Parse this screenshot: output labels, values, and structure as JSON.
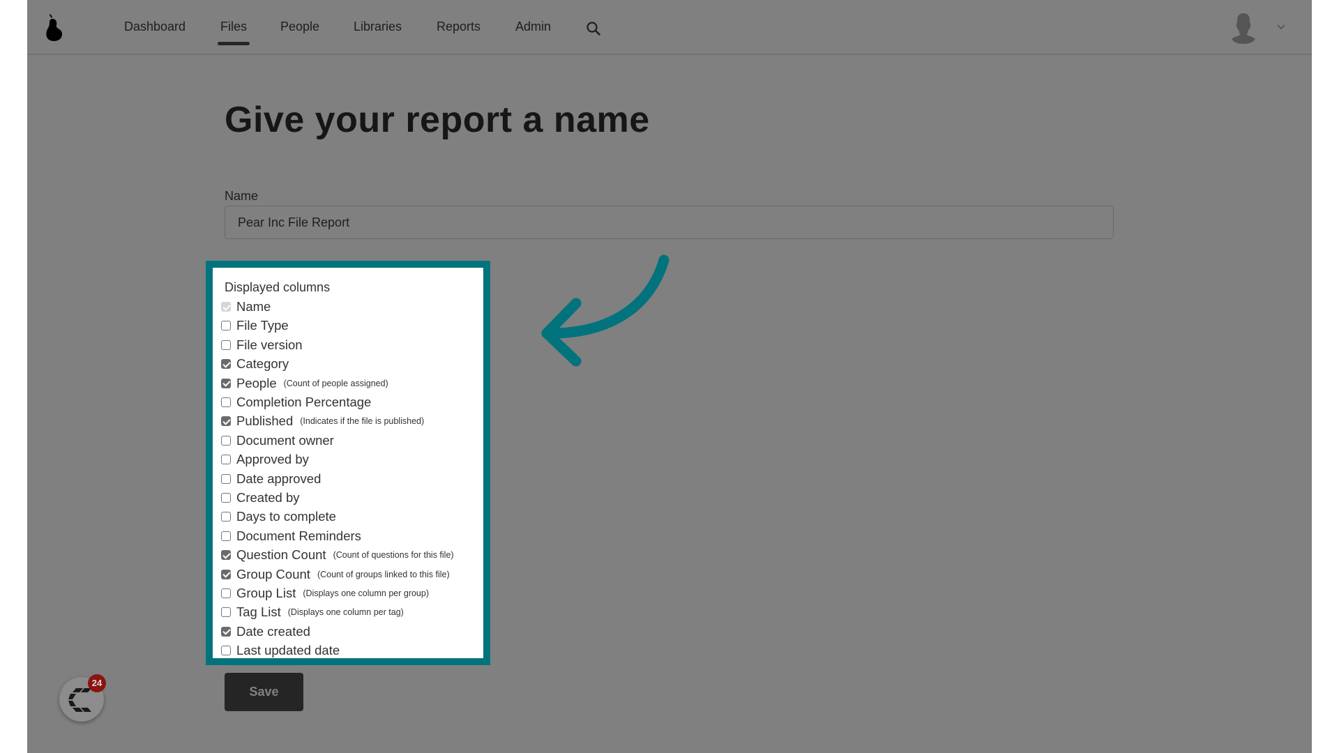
{
  "header": {
    "logo_icon": "pear-logo-icon",
    "nav": [
      {
        "label": "Dashboard",
        "active": false
      },
      {
        "label": "Files",
        "active": true
      },
      {
        "label": "People",
        "active": false
      },
      {
        "label": "Libraries",
        "active": false
      },
      {
        "label": "Reports",
        "active": false
      },
      {
        "label": "Admin",
        "active": false
      }
    ],
    "search_icon": "search-icon",
    "avatar_icon": "user-avatar-icon",
    "menu_icon": "chevron-down-icon"
  },
  "main": {
    "title": "Give your report a name",
    "name_field": {
      "label": "Name",
      "value": "Pear Inc File Report"
    },
    "columns_panel": {
      "heading": "Displayed columns",
      "items": [
        {
          "label": "Name",
          "desc": "",
          "checked": true,
          "disabled": true
        },
        {
          "label": "File Type",
          "desc": "",
          "checked": false,
          "disabled": false
        },
        {
          "label": "File version",
          "desc": "",
          "checked": false,
          "disabled": false
        },
        {
          "label": "Category",
          "desc": "",
          "checked": true,
          "disabled": false
        },
        {
          "label": "People",
          "desc": "(Count of people assigned)",
          "checked": true,
          "disabled": false
        },
        {
          "label": "Completion Percentage",
          "desc": "",
          "checked": false,
          "disabled": false
        },
        {
          "label": "Published",
          "desc": "(Indicates if the file is published)",
          "checked": true,
          "disabled": false
        },
        {
          "label": "Document owner",
          "desc": "",
          "checked": false,
          "disabled": false
        },
        {
          "label": "Approved by",
          "desc": "",
          "checked": false,
          "disabled": false
        },
        {
          "label": "Date approved",
          "desc": "",
          "checked": false,
          "disabled": false
        },
        {
          "label": "Created by",
          "desc": "",
          "checked": false,
          "disabled": false
        },
        {
          "label": "Days to complete",
          "desc": "",
          "checked": false,
          "disabled": false
        },
        {
          "label": "Document Reminders",
          "desc": "",
          "checked": false,
          "disabled": false
        },
        {
          "label": "Question Count",
          "desc": "(Count of questions for this file)",
          "checked": true,
          "disabled": false
        },
        {
          "label": "Group Count",
          "desc": "(Count of groups linked to this file)",
          "checked": true,
          "disabled": false
        },
        {
          "label": "Group List",
          "desc": "(Displays one column per group)",
          "checked": false,
          "disabled": false
        },
        {
          "label": "Tag List",
          "desc": "(Displays one column per tag)",
          "checked": false,
          "disabled": false
        },
        {
          "label": "Date created",
          "desc": "",
          "checked": true,
          "disabled": false
        },
        {
          "label": "Last updated date",
          "desc": "",
          "checked": false,
          "disabled": false
        }
      ]
    },
    "save_label": "Save"
  },
  "annotation": {
    "arrow_icon": "curved-arrow-icon",
    "highlight_color": "#00737d"
  },
  "chat_widget": {
    "icon": "chat-widget-logo-icon",
    "badge_count": "24"
  }
}
